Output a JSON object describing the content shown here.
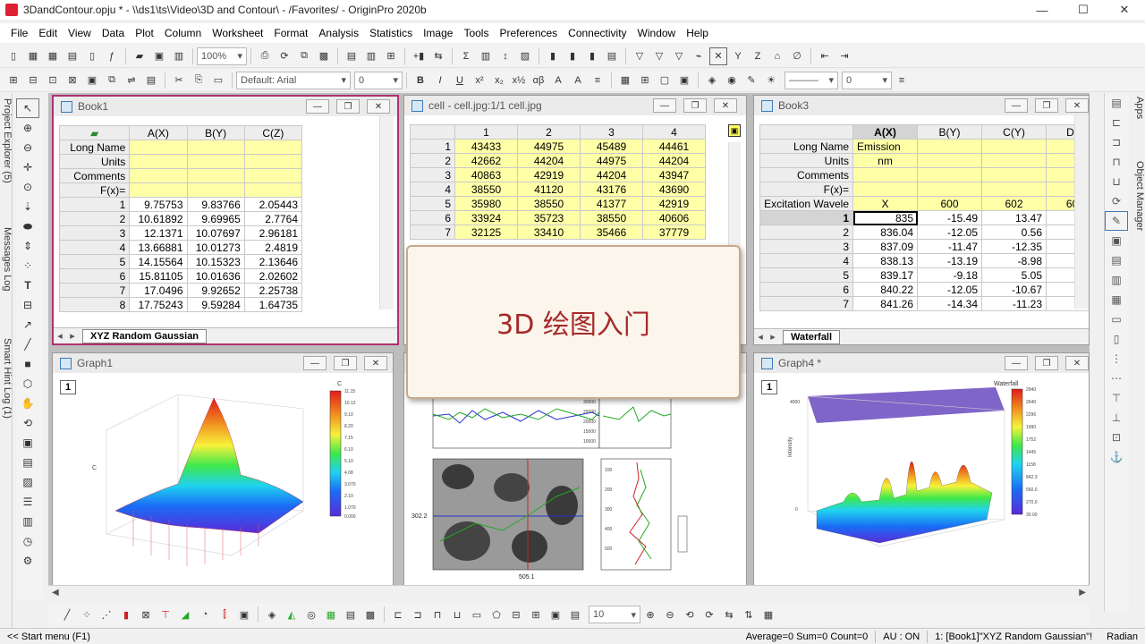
{
  "window": {
    "title": "3DandContour.opju * - \\\\ds1\\ts\\Video\\3D and Contour\\ - /Favorites/ - OriginPro 2020b",
    "minimize": "—",
    "maximize": "☐",
    "close": "✕"
  },
  "menu": [
    "File",
    "Edit",
    "View",
    "Data",
    "Plot",
    "Column",
    "Worksheet",
    "Format",
    "Analysis",
    "Statistics",
    "Image",
    "Tools",
    "Preferences",
    "Connectivity",
    "Window",
    "Help"
  ],
  "toolbar1": {
    "zoom": "100%"
  },
  "toolbar2": {
    "font": "Default: Arial",
    "font_size": "0",
    "bold": "B",
    "italic": "I",
    "underline": "U",
    "line_width": "0"
  },
  "left_tabs": {
    "project_explorer": "Project Explorer (5)",
    "messages_log": "Messages Log",
    "smart_hint_log": "Smart Hint Log (1)"
  },
  "right_tabs": {
    "apps": "Apps",
    "object_manager": "Object Manager"
  },
  "book1": {
    "title": "Book1",
    "columns": [
      "A(X)",
      "B(Y)",
      "C(Z)"
    ],
    "meta_rows": [
      "Long Name",
      "Units",
      "Comments",
      "F(x)="
    ],
    "rows": [
      [
        "1",
        "9.75753",
        "9.83766",
        "2.05443"
      ],
      [
        "2",
        "10.61892",
        "9.69965",
        "2.7764"
      ],
      [
        "3",
        "12.1371",
        "10.07697",
        "2.96181"
      ],
      [
        "4",
        "13.66881",
        "10.01273",
        "2.4819"
      ],
      [
        "5",
        "14.15564",
        "10.15323",
        "2.13646"
      ],
      [
        "6",
        "15.81105",
        "10.01636",
        "2.02602"
      ],
      [
        "7",
        "17.0496",
        "9.92652",
        "2.25738"
      ],
      [
        "8",
        "17.75243",
        "9.59284",
        "1.64735"
      ]
    ],
    "sheet_tab": "XYZ Random Gaussian"
  },
  "cell": {
    "title": "cell - cell.jpg:1/1 cell.jpg",
    "columns": [
      "1",
      "2",
      "3",
      "4"
    ],
    "rows": [
      [
        "1",
        "43433",
        "44975",
        "45489",
        "44461"
      ],
      [
        "2",
        "42662",
        "44204",
        "44975",
        "44204"
      ],
      [
        "3",
        "40863",
        "42919",
        "44204",
        "43947"
      ],
      [
        "4",
        "38550",
        "41120",
        "43176",
        "43690"
      ],
      [
        "5",
        "35980",
        "38550",
        "41377",
        "42919"
      ],
      [
        "6",
        "33924",
        "35723",
        "38550",
        "40606"
      ],
      [
        "7",
        "32125",
        "33410",
        "35466",
        "37779"
      ]
    ]
  },
  "book3": {
    "title": "Book3",
    "columns": [
      "A(X)",
      "B(Y)",
      "C(Y)",
      "D("
    ],
    "long_name": "Emission",
    "units": "nm",
    "meta_rows": [
      "Long Name",
      "Units",
      "Comments",
      "F(x)=",
      "Excitation Wavele"
    ],
    "excitation": [
      "X",
      "600",
      "602",
      "60"
    ],
    "rows": [
      [
        "1",
        "835",
        "-15.49",
        "13.47",
        ""
      ],
      [
        "2",
        "836.04",
        "-12.05",
        "0.56",
        "-"
      ],
      [
        "3",
        "837.09",
        "-11.47",
        "-12.35",
        "-"
      ],
      [
        "4",
        "838.13",
        "-13.19",
        "-8.98",
        ""
      ],
      [
        "5",
        "839.17",
        "-9.18",
        "5.05",
        "-"
      ],
      [
        "6",
        "840.22",
        "-12.05",
        "-10.67",
        "-"
      ],
      [
        "7",
        "841.26",
        "-14.34",
        "-11.23",
        "-"
      ]
    ],
    "sheet_tab": "Waterfall"
  },
  "graph1": {
    "title": "Graph1",
    "layer": "1",
    "colorbar_title": "C",
    "z_label": "C",
    "colorbar_ticks": [
      "11.15",
      "10.12",
      "9.10",
      "8.20",
      "7.15",
      "6.10",
      "5.10",
      "4.08",
      "3.070",
      "2.10",
      "1.070",
      "0.000"
    ]
  },
  "graph4": {
    "title": "Graph4 *",
    "layer": "1",
    "colorbar_title": "Waterfall",
    "z_label": "Intensity",
    "z_ticks": [
      "4000",
      "0"
    ],
    "colorbar_ticks": [
      "2940",
      "2640",
      "2296",
      "1990",
      "1752",
      "1445",
      "1158",
      "842.3",
      "560.0",
      "270.0",
      "30.00"
    ]
  },
  "cell_graph": {
    "x_readout": "505.1",
    "y_readout": "302.2",
    "top_y_ticks": [
      "30000",
      "25000",
      "20000",
      "15000",
      "10000"
    ],
    "side_y_ticks": [
      "100",
      "200",
      "300",
      "400",
      "500"
    ]
  },
  "popup": {
    "text": "3D 绘图入门"
  },
  "bottom_toolbar": {
    "size": "10"
  },
  "statusbar": {
    "start": "<< Start menu (F1)",
    "stats": "Average=0 Sum=0 Count=0",
    "au": "AU : ON",
    "sheet": "1: [Book1]\"XYZ Random Gaussian\"!",
    "unit": "Radian"
  },
  "colors": {
    "active_border": "#b0316f",
    "yellow_cells": "#ffffa8",
    "popup_text": "#a52a2a"
  }
}
